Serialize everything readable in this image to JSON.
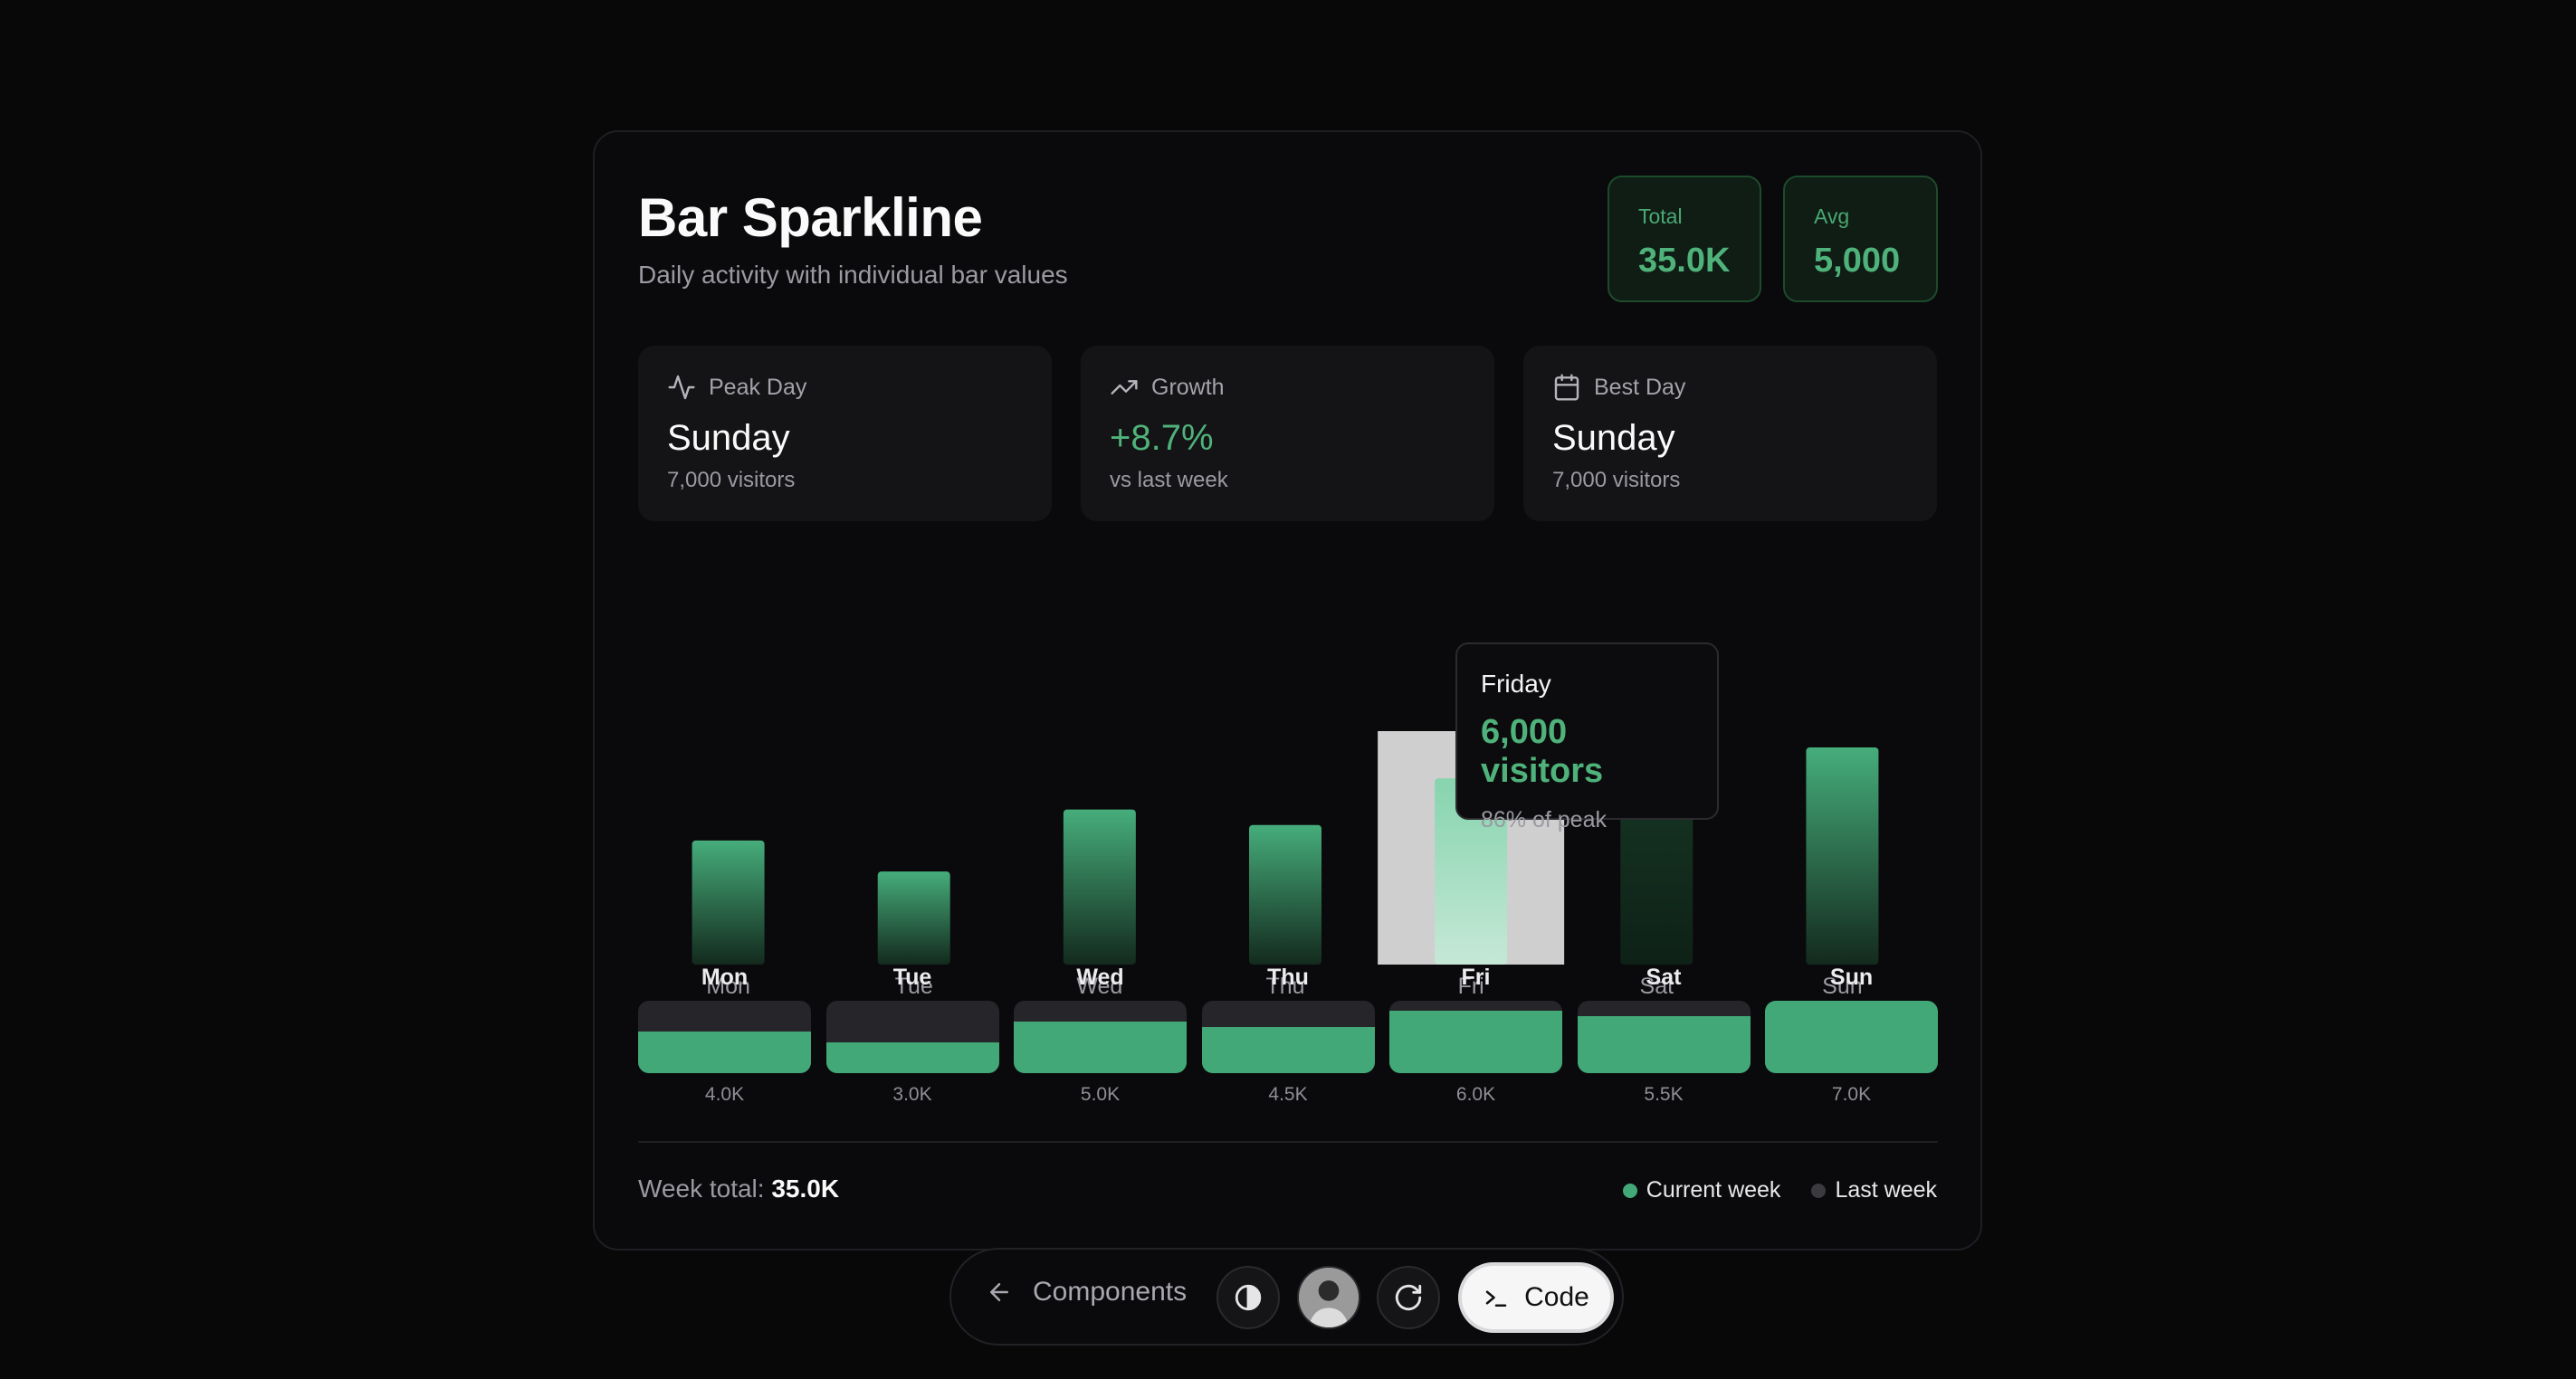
{
  "header": {
    "title": "Bar Sparkline",
    "subtitle": "Daily activity with individual bar values"
  },
  "kpis": {
    "total": {
      "label": "Total",
      "value": "35.0K"
    },
    "avg": {
      "label": "Avg",
      "value": "5,000"
    }
  },
  "stats": {
    "peak": {
      "label": "Peak Day",
      "value": "Sunday",
      "sub": "7,000 visitors",
      "icon": "activity-icon"
    },
    "growth": {
      "label": "Growth",
      "value": "+8.7%",
      "sub": "vs last week",
      "icon": "trending-up-icon"
    },
    "best": {
      "label": "Best Day",
      "value": "Sunday",
      "sub": "7,000 visitors",
      "icon": "calendar-icon"
    }
  },
  "chart_data": {
    "type": "bar",
    "categories": [
      "Mon",
      "Tue",
      "Wed",
      "Thu",
      "Fri",
      "Sat",
      "Sun"
    ],
    "values": [
      4000,
      3000,
      5000,
      4500,
      6000,
      5500,
      7000
    ],
    "ylim": [
      0,
      7000
    ],
    "highlighted": "Fri",
    "colors": {
      "bar": "#43a877",
      "bar_dim": "#14301f",
      "highlight_bg": "#cfcfcf"
    }
  },
  "tooltip": {
    "title": "Friday",
    "value": "6,000 visitors",
    "sub": "86% of peak"
  },
  "mini": {
    "days": [
      "Mon",
      "Tue",
      "Wed",
      "Thu",
      "Fri",
      "Sat",
      "Sun"
    ],
    "labels": [
      "4.0K",
      "3.0K",
      "5.0K",
      "4.5K",
      "6.0K",
      "5.5K",
      "7.0K"
    ],
    "fractions": [
      0.57,
      0.43,
      0.71,
      0.64,
      0.86,
      0.79,
      1.0
    ]
  },
  "footer": {
    "week_label": "Week total:",
    "week_value": "35.0K",
    "legend_current": "Current week",
    "legend_last": "Last week",
    "color_current": "#43a877",
    "color_last": "#3a3a3f"
  },
  "toolbar": {
    "back_label": "Components",
    "code_label": "Code"
  }
}
